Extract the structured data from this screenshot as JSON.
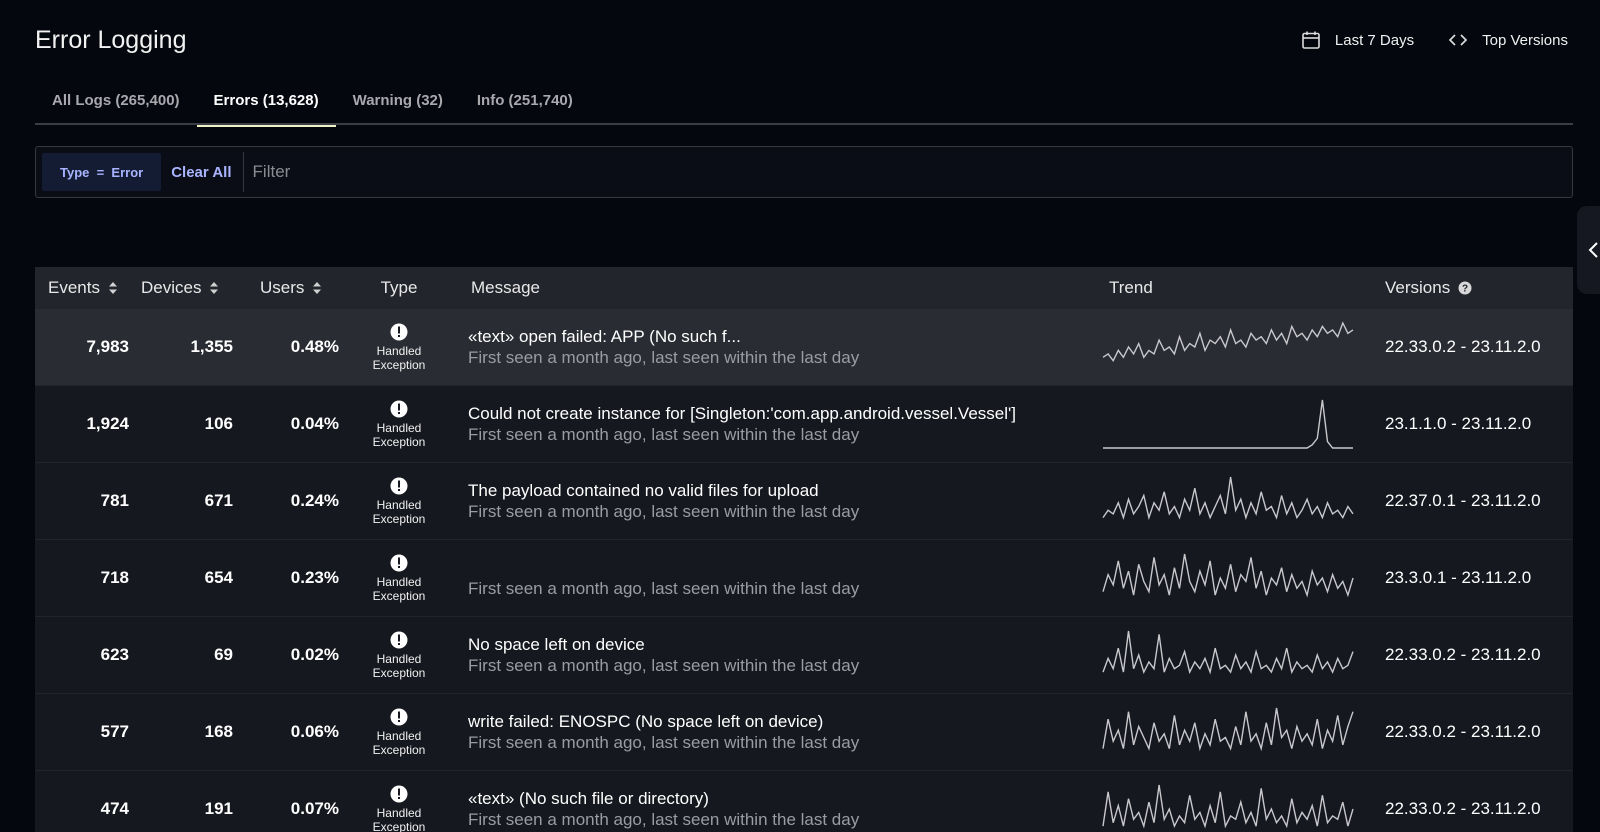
{
  "header": {
    "title": "Error Logging",
    "date_range_label": "Last 7 Days",
    "top_versions_label": "Top Versions"
  },
  "tabs": [
    {
      "label": "All Logs (265,400)",
      "active": false
    },
    {
      "label": "Errors (13,628)",
      "active": true
    },
    {
      "label": "Warning (32)",
      "active": false
    },
    {
      "label": "Info (251,740)",
      "active": false
    }
  ],
  "filter": {
    "chip_label": "Type  =  Error",
    "clear_all_label": "Clear All",
    "placeholder": "Filter"
  },
  "table": {
    "columns": {
      "events": "Events",
      "devices": "Devices",
      "users": "Users",
      "type": "Type",
      "message": "Message",
      "trend": "Trend",
      "versions": "Versions"
    },
    "rows": [
      {
        "events": "7,983",
        "devices": "1,355",
        "users": "0.48%",
        "type": "Handled Exception",
        "message": "«text» open failed: APP (No such f...",
        "seen": "First seen a month ago, last seen within the last day",
        "versions": "22.33.0.2 - 23.11.2.0",
        "trend": [
          4,
          5,
          3,
          6,
          4,
          7,
          5,
          8,
          4,
          6,
          5,
          9,
          6,
          7,
          5,
          10,
          6,
          8,
          7,
          11,
          6,
          9,
          8,
          10,
          7,
          12,
          8,
          9,
          7,
          11,
          9,
          10,
          8,
          12,
          9,
          11,
          8,
          13,
          10,
          11,
          9,
          12,
          10,
          13,
          11,
          12,
          10,
          14,
          11,
          12
        ]
      },
      {
        "events": "1,924",
        "devices": "106",
        "users": "0.04%",
        "type": "Handled Exception",
        "message": "Could not create instance for [Singleton:'com.app.android.vessel.Vessel']",
        "seen": "First seen a month ago, last seen within the last day",
        "versions": "23.1.1.0 - 23.11.2.0",
        "trend": [
          0,
          0,
          0,
          0,
          0,
          0,
          0,
          0,
          0,
          0,
          0,
          0,
          0,
          0,
          0,
          0,
          0,
          0,
          0,
          0,
          0,
          0,
          0,
          0,
          0,
          0,
          0,
          0,
          0,
          0,
          0,
          0,
          0,
          0,
          0,
          0,
          0,
          0,
          0,
          0,
          0,
          1,
          3,
          15,
          2,
          0,
          0,
          0,
          0,
          0
        ]
      },
      {
        "events": "781",
        "devices": "671",
        "users": "0.24%",
        "type": "Handled Exception",
        "message": "The payload contained no valid files for upload",
        "seen": "First seen a month ago, last seen within the last day",
        "versions": "22.37.0.1 - 23.11.2.0",
        "trend": [
          2,
          4,
          3,
          6,
          2,
          7,
          3,
          5,
          8,
          2,
          6,
          4,
          9,
          3,
          5,
          2,
          7,
          4,
          10,
          3,
          6,
          2,
          5,
          8,
          3,
          13,
          4,
          7,
          2,
          6,
          3,
          9,
          4,
          5,
          2,
          8,
          3,
          6,
          2,
          4,
          7,
          3,
          5,
          2,
          6,
          3,
          4,
          2,
          5,
          3
        ]
      },
      {
        "events": "718",
        "devices": "654",
        "users": "0.23%",
        "type": "Handled Exception",
        "message": "",
        "seen": "First seen a month ago, last seen within the last day",
        "versions": "23.3.0.1 - 23.11.2.0",
        "trend": [
          3,
          8,
          5,
          12,
          4,
          9,
          2,
          11,
          6,
          3,
          13,
          5,
          8,
          2,
          10,
          4,
          14,
          6,
          3,
          9,
          5,
          12,
          2,
          7,
          4,
          11,
          3,
          8,
          6,
          13,
          4,
          9,
          2,
          7,
          5,
          10,
          3,
          8,
          4,
          6,
          2,
          9,
          5,
          7,
          3,
          8,
          4,
          6,
          2,
          7
        ]
      },
      {
        "events": "623",
        "devices": "69",
        "users": "0.02%",
        "type": "Handled Exception",
        "message": "No space left on device",
        "seen": "First seen a month ago, last seen within the last day",
        "versions": "22.33.0.2 - 23.11.2.0",
        "trend": [
          2,
          6,
          3,
          9,
          2,
          14,
          3,
          7,
          2,
          5,
          3,
          13,
          2,
          6,
          3,
          4,
          8,
          2,
          5,
          3,
          6,
          2,
          9,
          3,
          4,
          2,
          7,
          3,
          5,
          2,
          8,
          3,
          4,
          2,
          6,
          3,
          9,
          2,
          5,
          3,
          4,
          2,
          7,
          3,
          5,
          2,
          6,
          3,
          4,
          8
        ]
      },
      {
        "events": "577",
        "devices": "168",
        "users": "0.06%",
        "type": "Handled Exception",
        "message": "write failed: ENOSPC (No space left on device)",
        "seen": "First seen a month ago, last seen within the last day",
        "versions": "22.33.0.2 - 23.11.2.0",
        "trend": [
          2,
          10,
          4,
          7,
          2,
          12,
          3,
          8,
          5,
          2,
          9,
          4,
          6,
          2,
          11,
          3,
          7,
          4,
          9,
          2,
          6,
          3,
          10,
          4,
          5,
          2,
          8,
          3,
          12,
          4,
          6,
          2,
          9,
          3,
          13,
          5,
          7,
          2,
          8,
          4,
          6,
          3,
          10,
          2,
          7,
          4,
          11,
          3,
          8,
          12
        ]
      },
      {
        "events": "474",
        "devices": "191",
        "users": "0.07%",
        "type": "Handled Exception",
        "message": "«text» (No such file or directory)",
        "seen": "First seen a month ago, last seen within the last day",
        "versions": "22.33.0.2 - 23.11.2.0",
        "trend": [
          2,
          12,
          3,
          8,
          2,
          10,
          4,
          6,
          2,
          9,
          3,
          14,
          4,
          7,
          2,
          5,
          3,
          11,
          4,
          6,
          2,
          8,
          3,
          12,
          2,
          5,
          4,
          9,
          3,
          6,
          2,
          13,
          4,
          7,
          3,
          5,
          2,
          10,
          3,
          6,
          4,
          8,
          2,
          11,
          3,
          5,
          4,
          9,
          2,
          7
        ]
      }
    ]
  },
  "colors": {
    "background": "#05070f",
    "accent": "#a8b4ff",
    "trend_line": "#c8c8cc",
    "active_tab_underline": "#f2f2c8"
  },
  "icons": {
    "date_range": "calendar-icon",
    "top_versions": "code-brackets-icon",
    "type": "exclamation-circle-icon",
    "sort": "sort-arrows-icon",
    "versions_help": "help-circle-icon",
    "side_toggle": "chevron-left-icon"
  }
}
